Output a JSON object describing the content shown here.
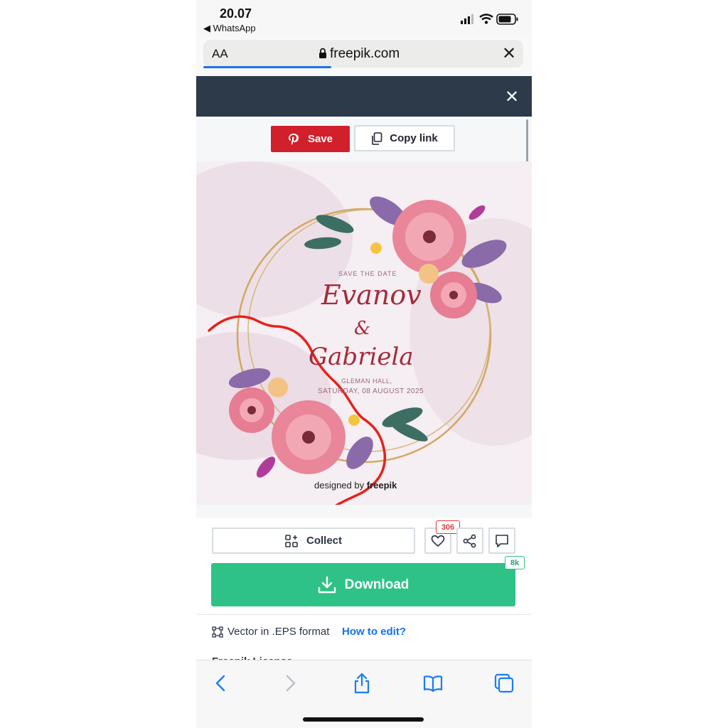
{
  "status_bar": {
    "time": "20.07",
    "back_app": "◀ WhatsApp"
  },
  "url_bar": {
    "text_size": "AA",
    "domain": "freepik.com"
  },
  "share_modal": {
    "save_label": "Save",
    "copy_label": "Copy link"
  },
  "artwork": {
    "save_the_date": "SAVE THE DATE",
    "name1": "Evanov",
    "ampersand": "&",
    "name2": "Gabriela",
    "venue": "GLEMAN HALL,",
    "date": "SATURDAY, 08 AUGUST 2025",
    "designed_by": "designed by",
    "brand": "freepik"
  },
  "actions": {
    "collect_label": "Collect",
    "likes_count": "306",
    "download_label": "Download",
    "download_count": "8k"
  },
  "file_info": {
    "format": "Vector in .EPS format",
    "how_to_edit": "How to edit?",
    "license": "Freepik License"
  },
  "colors": {
    "save_red": "#d1202b",
    "download_green": "#2ec286",
    "header_dark": "#2d3a49",
    "link_blue": "#1273eb",
    "scribble_red": "#e8201c"
  }
}
